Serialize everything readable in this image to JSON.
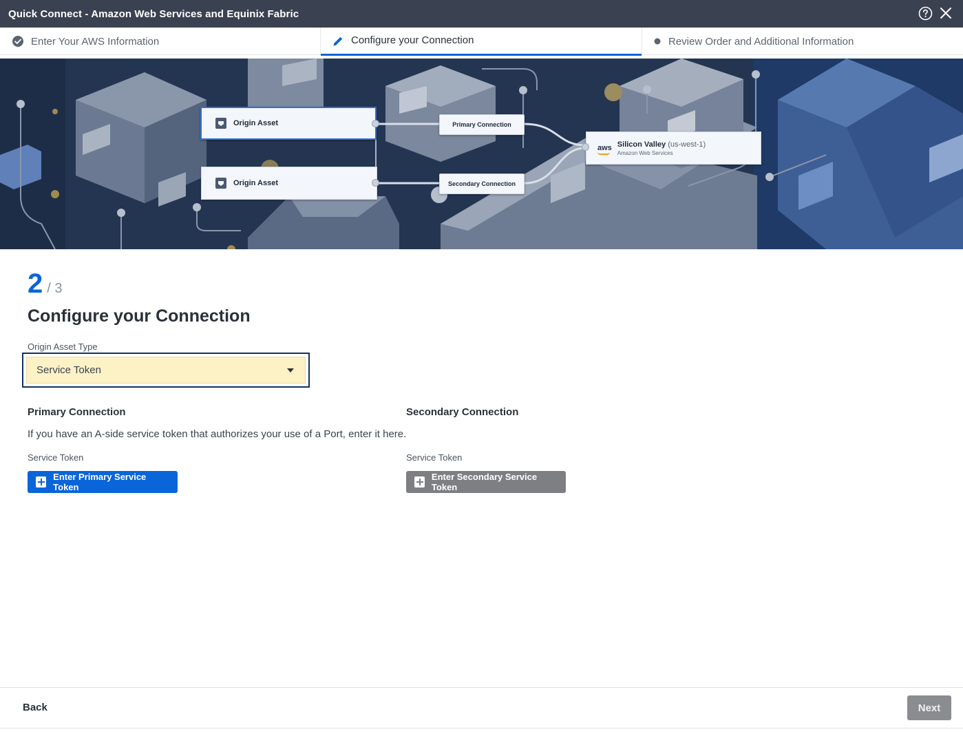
{
  "window": {
    "title": "Quick Connect - Amazon Web Services and Equinix Fabric"
  },
  "steps": [
    {
      "label": "Enter Your AWS Information",
      "state": "complete"
    },
    {
      "label": "Configure your Connection",
      "state": "active"
    },
    {
      "label": "Review Order and Additional Information",
      "state": "pending"
    }
  ],
  "diagram": {
    "origin_primary": "Origin Asset",
    "origin_secondary": "Origin Asset",
    "primary_connection": "Primary Connection",
    "secondary_connection": "Secondary Connection",
    "aws_logo": "aws",
    "destination": "Silicon Valley",
    "destination_region": "(us-west-1)",
    "destination_provider": "Amazon Web Services"
  },
  "progress": {
    "current": "2",
    "total": "/ 3"
  },
  "page": {
    "title": "Configure your Connection"
  },
  "origin_asset": {
    "label": "Origin Asset Type",
    "value": "Service Token"
  },
  "primary": {
    "heading": "Primary Connection",
    "description": "If you have an A-side service token that authorizes your use of a Port, enter it here.",
    "field_label": "Service Token",
    "button_label": "Enter Primary Service Token"
  },
  "secondary": {
    "heading": "Secondary Connection",
    "field_label": "Service Token",
    "button_label": "Enter Secondary Service Token"
  },
  "footer": {
    "back_label": "Back",
    "next_label": "Next"
  },
  "colors": {
    "accent": "#0a65d8",
    "titlebar": "#3a4150",
    "select_bg": "#fdf1c6",
    "disabled": "#7d7f82"
  }
}
